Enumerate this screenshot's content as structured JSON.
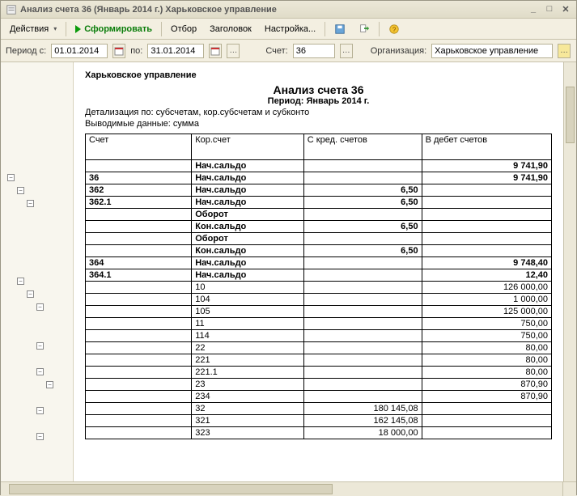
{
  "window": {
    "title": "Анализ счета 36 (Январь 2014 г.) Харьковское управление"
  },
  "toolbar": {
    "actions": "Действия",
    "run": "Сформировать",
    "filter": "Отбор",
    "header": "Заголовок",
    "settings": "Настройка..."
  },
  "params": {
    "period_label": "Период с:",
    "date_from": "01.01.2014",
    "to_label": "по:",
    "date_to": "31.01.2014",
    "account_label": "Счет:",
    "account": "36",
    "org_label": "Организация:",
    "org": "Харьковское управление"
  },
  "report": {
    "org": "Харьковское управление",
    "title": "Анализ счета 36",
    "period": "Период: Январь 2014 г.",
    "detail": "Детализация по: субсчетам, кор.субсчетам и субконто",
    "output": "Выводимые данные: сумма",
    "cols": {
      "c1": "Счет",
      "c2": "Кор.счет",
      "c3": "С кред. счетов",
      "c4": "В дебет счетов"
    },
    "rows": [
      {
        "a": "",
        "b": "Нач.сальдо",
        "c": "",
        "d": "9 741,90",
        "bold": true
      },
      {
        "a": "36",
        "b": "Нач.сальдо",
        "c": "",
        "d": "9 741,90",
        "bold": true
      },
      {
        "a": "362",
        "b": "Нач.сальдо",
        "c": "6,50",
        "d": "",
        "bold": true
      },
      {
        "a": "362.1",
        "b": "Нач.сальдо",
        "c": "6,50",
        "d": "",
        "bold": true
      },
      {
        "a": "",
        "b": "Оборот",
        "c": "",
        "d": "",
        "bold": true
      },
      {
        "a": "",
        "b": "Кон.сальдо",
        "c": "6,50",
        "d": "",
        "bold": true
      },
      {
        "a": "",
        "b": "Оборот",
        "c": "",
        "d": "",
        "bold": true
      },
      {
        "a": "",
        "b": "Кон.сальдо",
        "c": "6,50",
        "d": "",
        "bold": true
      },
      {
        "a": "364",
        "b": "Нач.сальдо",
        "c": "",
        "d": "9 748,40",
        "bold": true
      },
      {
        "a": "364.1",
        "b": "Нач.сальдо",
        "c": "",
        "d": "12,40",
        "bold": true
      },
      {
        "a": "",
        "b": "10",
        "c": "",
        "d": "126 000,00"
      },
      {
        "a": "",
        "b": "104",
        "c": "",
        "d": "1 000,00"
      },
      {
        "a": "",
        "b": "105",
        "c": "",
        "d": "125 000,00"
      },
      {
        "a": "",
        "b": "11",
        "c": "",
        "d": "750,00"
      },
      {
        "a": "",
        "b": "114",
        "c": "",
        "d": "750,00"
      },
      {
        "a": "",
        "b": "22",
        "c": "",
        "d": "80,00"
      },
      {
        "a": "",
        "b": "221",
        "c": "",
        "d": "80,00"
      },
      {
        "a": "",
        "b": "221.1",
        "c": "",
        "d": "80,00"
      },
      {
        "a": "",
        "b": "23",
        "c": "",
        "d": "870,90"
      },
      {
        "a": "",
        "b": "234",
        "c": "",
        "d": "870,90"
      },
      {
        "a": "",
        "b": "32",
        "c": "180 145,08",
        "d": ""
      },
      {
        "a": "",
        "b": "321",
        "c": "162 145,08",
        "d": ""
      },
      {
        "a": "",
        "b": "323",
        "c": "18 000,00",
        "d": ""
      }
    ]
  }
}
